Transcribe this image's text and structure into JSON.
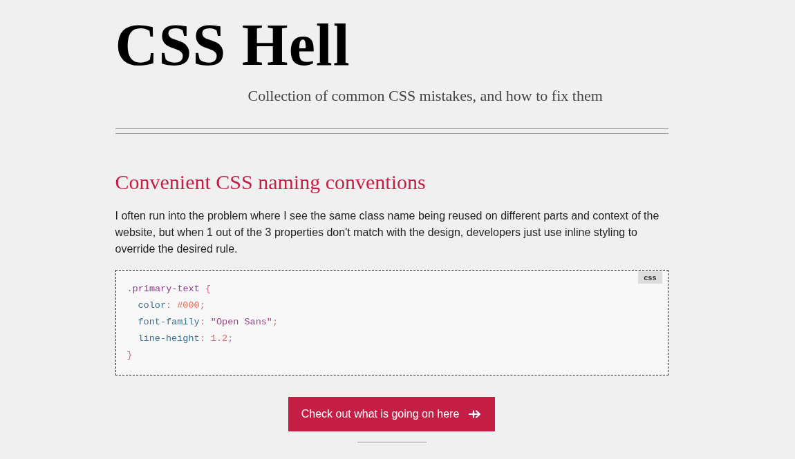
{
  "header": {
    "title": "CSS Hell",
    "tagline": "Collection of common CSS mistakes, and how to fix them"
  },
  "article": {
    "heading": "Convenient CSS naming conventions",
    "paragraph": "I often run into the problem where I see the same class name being reused on different parts and context of the website, but when 1 out of the 3 properties don't match with the design, developers just use inline styling to override the desired rule.",
    "code_block": {
      "language": "css",
      "rule": {
        "selector": ".primary-text",
        "open_brace": "{",
        "declarations": [
          {
            "kind": "hex",
            "property": "color",
            "colon": ":",
            "value": "#000",
            "semicolon": ";"
          },
          {
            "kind": "string",
            "property": "font-family",
            "colon": ":",
            "value": "\"Open Sans\"",
            "semicolon": ";"
          },
          {
            "kind": "number",
            "property": "line-height",
            "colon": ":",
            "value": "1.2",
            "semicolon": ";"
          }
        ],
        "close_brace": "}"
      }
    },
    "button": {
      "label": "Check out what is going on here"
    }
  }
}
